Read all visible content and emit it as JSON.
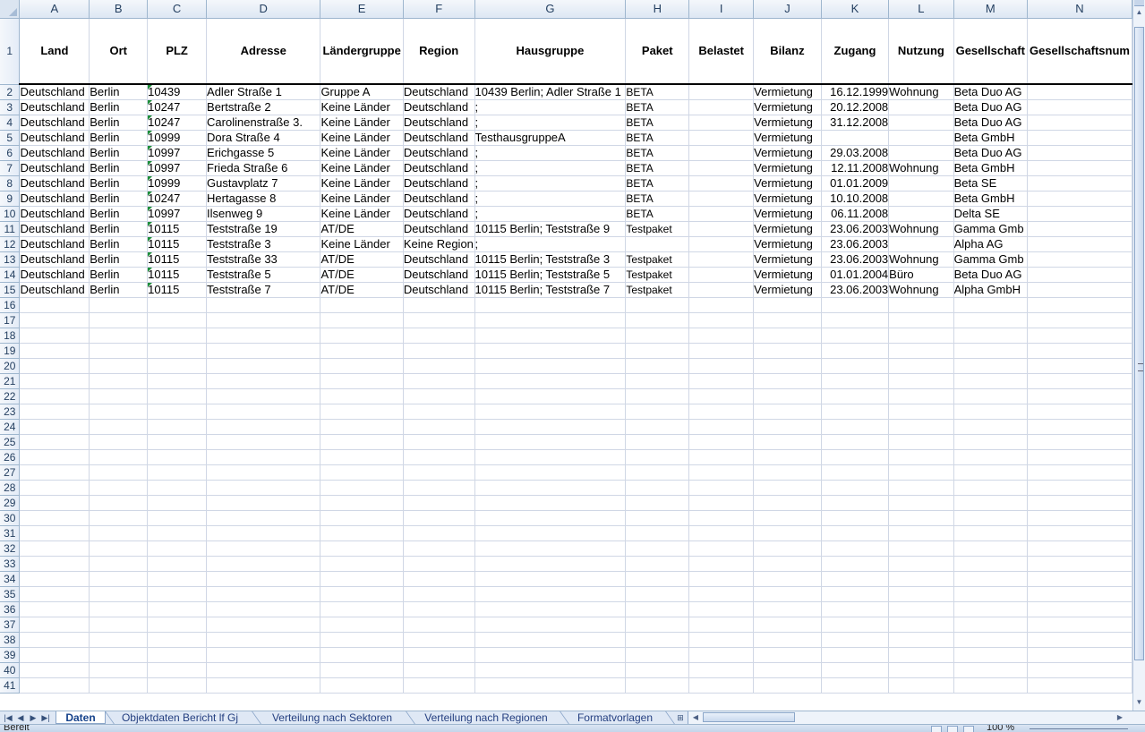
{
  "columns": [
    "A",
    "B",
    "C",
    "D",
    "E",
    "F",
    "G",
    "H",
    "I",
    "J",
    "K",
    "L",
    "M",
    "N"
  ],
  "header_row": {
    "row_number": "1",
    "cells": [
      "Land",
      "Ort",
      "PLZ",
      "Adresse",
      "Ländergruppe",
      "Region",
      "Hausgruppe",
      "Paket",
      "Belastet",
      "Bilanz",
      "Zugang",
      "Nutzung",
      "Gesellschaft",
      "Gesellschaftsnum"
    ]
  },
  "rows": [
    {
      "n": "2",
      "cells": [
        "Deutschland",
        "Berlin",
        "10439",
        "Adler Straße 1",
        "Gruppe A",
        "Deutschland",
        "10439 Berlin; Adler Straße 1",
        "BETA",
        "",
        "Vermietung",
        "16.12.1999",
        "Wohnung",
        "Beta Duo AG",
        ""
      ]
    },
    {
      "n": "3",
      "cells": [
        "Deutschland",
        "Berlin",
        "10247",
        "Bertstraße 2",
        "Keine Länder",
        "Deutschland",
        ";",
        "BETA",
        "",
        "Vermietung",
        "20.12.2008",
        "",
        "Beta Duo AG",
        ""
      ]
    },
    {
      "n": "4",
      "cells": [
        "Deutschland",
        "Berlin",
        "10247",
        "Carolinenstraße 3.",
        "Keine Länder",
        "Deutschland",
        ";",
        "BETA",
        "",
        "Vermietung",
        "31.12.2008",
        "",
        "Beta Duo AG",
        ""
      ]
    },
    {
      "n": "5",
      "cells": [
        "Deutschland",
        "Berlin",
        "10999",
        "Dora Straße 4",
        "Keine Länder",
        "Deutschland",
        "TesthausgruppeA",
        "BETA",
        "",
        "Vermietung",
        "",
        "",
        "Beta GmbH",
        ""
      ]
    },
    {
      "n": "6",
      "cells": [
        "Deutschland",
        "Berlin",
        "10997",
        "Erichgasse 5",
        "Keine Länder",
        "Deutschland",
        ";",
        "BETA",
        "",
        "Vermietung",
        "29.03.2008",
        "",
        "Beta Duo AG",
        ""
      ]
    },
    {
      "n": "7",
      "cells": [
        "Deutschland",
        "Berlin",
        "10997",
        "Frieda Straße 6",
        "Keine Länder",
        "Deutschland",
        ";",
        "BETA",
        "",
        "Vermietung",
        "12.11.2008",
        "Wohnung",
        "Beta GmbH",
        ""
      ]
    },
    {
      "n": "8",
      "cells": [
        "Deutschland",
        "Berlin",
        "10999",
        "Gustavplatz 7",
        "Keine Länder",
        "Deutschland",
        ";",
        "BETA",
        "",
        "Vermietung",
        "01.01.2009",
        "",
        "Beta SE",
        ""
      ]
    },
    {
      "n": "9",
      "cells": [
        "Deutschland",
        "Berlin",
        "10247",
        "Hertagasse 8",
        "Keine Länder",
        "Deutschland",
        ";",
        "BETA",
        "",
        "Vermietung",
        "10.10.2008",
        "",
        "Beta GmbH",
        ""
      ]
    },
    {
      "n": "10",
      "cells": [
        "Deutschland",
        "Berlin",
        "10997",
        "Ilsenweg 9",
        "Keine Länder",
        "Deutschland",
        ";",
        "BETA",
        "",
        "Vermietung",
        "06.11.2008",
        "",
        "Delta SE",
        ""
      ]
    },
    {
      "n": "11",
      "cells": [
        "Deutschland",
        "Berlin",
        "10115",
        "Teststraße 19",
        "AT/DE",
        "Deutschland",
        "10115 Berlin; Teststraße 9",
        "Testpaket",
        "",
        "Vermietung",
        "23.06.2003",
        "Wohnung",
        "Gamma Gmb",
        ""
      ]
    },
    {
      "n": "12",
      "cells": [
        "Deutschland",
        "Berlin",
        "10115",
        "Teststraße 3",
        "Keine Länder",
        "Keine Region",
        ";",
        "",
        "",
        "Vermietung",
        "23.06.2003",
        "",
        "Alpha AG",
        ""
      ]
    },
    {
      "n": "13",
      "cells": [
        "Deutschland",
        "Berlin",
        "10115",
        "Teststraße 33",
        "AT/DE",
        "Deutschland",
        "10115 Berlin; Teststraße 3",
        "Testpaket",
        "",
        "Vermietung",
        "23.06.2003",
        "Wohnung",
        "Gamma Gmb",
        ""
      ]
    },
    {
      "n": "14",
      "cells": [
        "Deutschland",
        "Berlin",
        "10115",
        "Teststraße 5",
        "AT/DE",
        "Deutschland",
        "10115 Berlin; Teststraße 5",
        "Testpaket",
        "",
        "Vermietung",
        "01.01.2004",
        "Büro",
        "Beta Duo AG",
        ""
      ]
    },
    {
      "n": "15",
      "cells": [
        "Deutschland",
        "Berlin",
        "10115",
        "Teststraße 7",
        "AT/DE",
        "Deutschland",
        "10115 Berlin; Teststraße 7",
        "Testpaket",
        "",
        "Vermietung",
        "23.06.2003",
        "Wohnung",
        "Alpha GmbH",
        ""
      ]
    }
  ],
  "empty_row_numbers": [
    "16",
    "17",
    "18",
    "19",
    "20",
    "21",
    "22",
    "23",
    "24",
    "25",
    "26",
    "27",
    "28",
    "29",
    "30",
    "31",
    "32",
    "33",
    "34",
    "35",
    "36",
    "37",
    "38",
    "39",
    "40",
    "41"
  ],
  "sheet_tabs": [
    {
      "label": "Daten",
      "active": true
    },
    {
      "label": "Objektdaten Bericht lf Gj",
      "active": false
    },
    {
      "label": "Verteilung nach Sektoren",
      "active": false
    },
    {
      "label": "Verteilung nach Regionen",
      "active": false
    },
    {
      "label": "Formatvorlagen",
      "active": false
    }
  ],
  "status_bar": {
    "text": "Bereit",
    "zoom": "100 %"
  },
  "colors": {
    "header_bg": "#dde7f3",
    "grid_line": "#d0d7e5",
    "tab_text": "#15428b",
    "error_indicator": "#1d8e3a"
  }
}
